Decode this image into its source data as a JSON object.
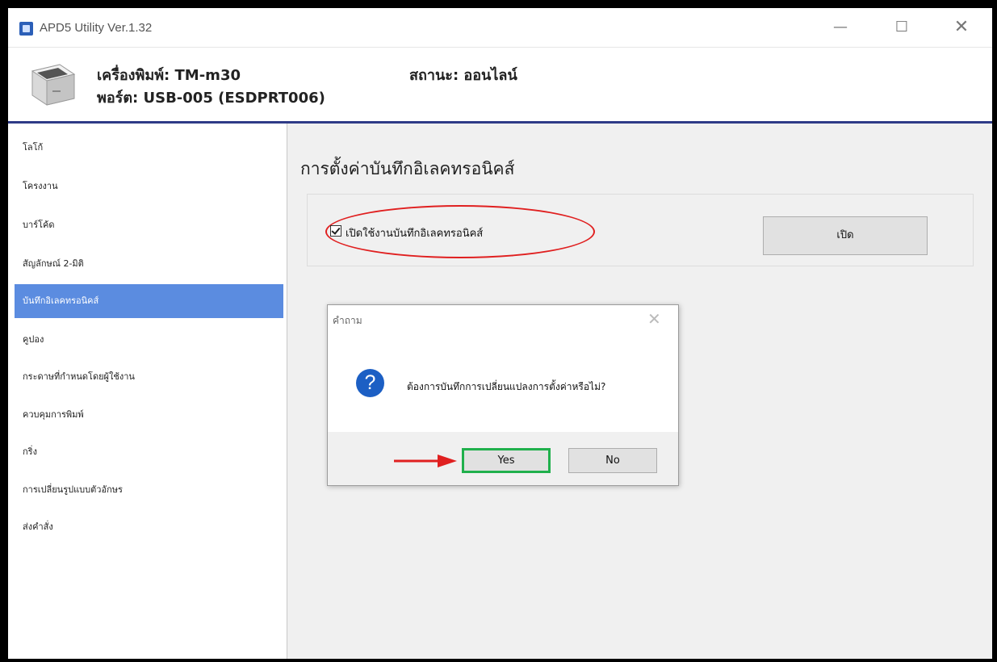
{
  "window": {
    "title": "APD5 Utility Ver.1.32",
    "minimize": "—",
    "maximize": "☐",
    "close": "✕"
  },
  "header": {
    "printer": "เครื่องพิมพ์: TM-m30",
    "port": "พอร์ต: USB-005 (ESDPRT006)",
    "status": "สถานะ: ออนไลน์"
  },
  "sidebar": {
    "items": [
      {
        "label": "โลโก้"
      },
      {
        "label": "โครงงาน"
      },
      {
        "label": "บาร์โค้ด"
      },
      {
        "label": "สัญลักษณ์ 2-มิติ"
      },
      {
        "label": "บันทึกอิเลคทรอนิคส์",
        "active": true
      },
      {
        "label": "คูปอง"
      },
      {
        "label": "กระดาษที่กำหนดโดยผู้ใช้งาน"
      },
      {
        "label": "ควบคุมการพิมพ์"
      },
      {
        "label": "กริ่ง"
      },
      {
        "label": "การเปลี่ยนรูปแบบตัวอักษร"
      },
      {
        "label": "ส่งคำสั่ง"
      }
    ]
  },
  "main": {
    "title": "การตั้งค่าบันทึกอิเลคทรอนิคส์",
    "checkbox_label": "เปิดใช้งานบันทึกอิเลคทรอนิคส์",
    "checkbox_checked": true,
    "open_button": "เปิด"
  },
  "dialog": {
    "title": "คำถาม",
    "close": "✕",
    "icon": "question-icon",
    "icon_glyph": "?",
    "message": "ต้องการบันทึกการเปลี่ยนแปลงการตั้งค่าหรือไม่?",
    "yes": "Yes",
    "no": "No"
  },
  "colors": {
    "sidebar_active": "#5b8ce0",
    "header_bar": "#2e3b87",
    "highlight_oval": "#e02020",
    "yes_highlight": "#20b04c",
    "arrow": "#e02020"
  }
}
